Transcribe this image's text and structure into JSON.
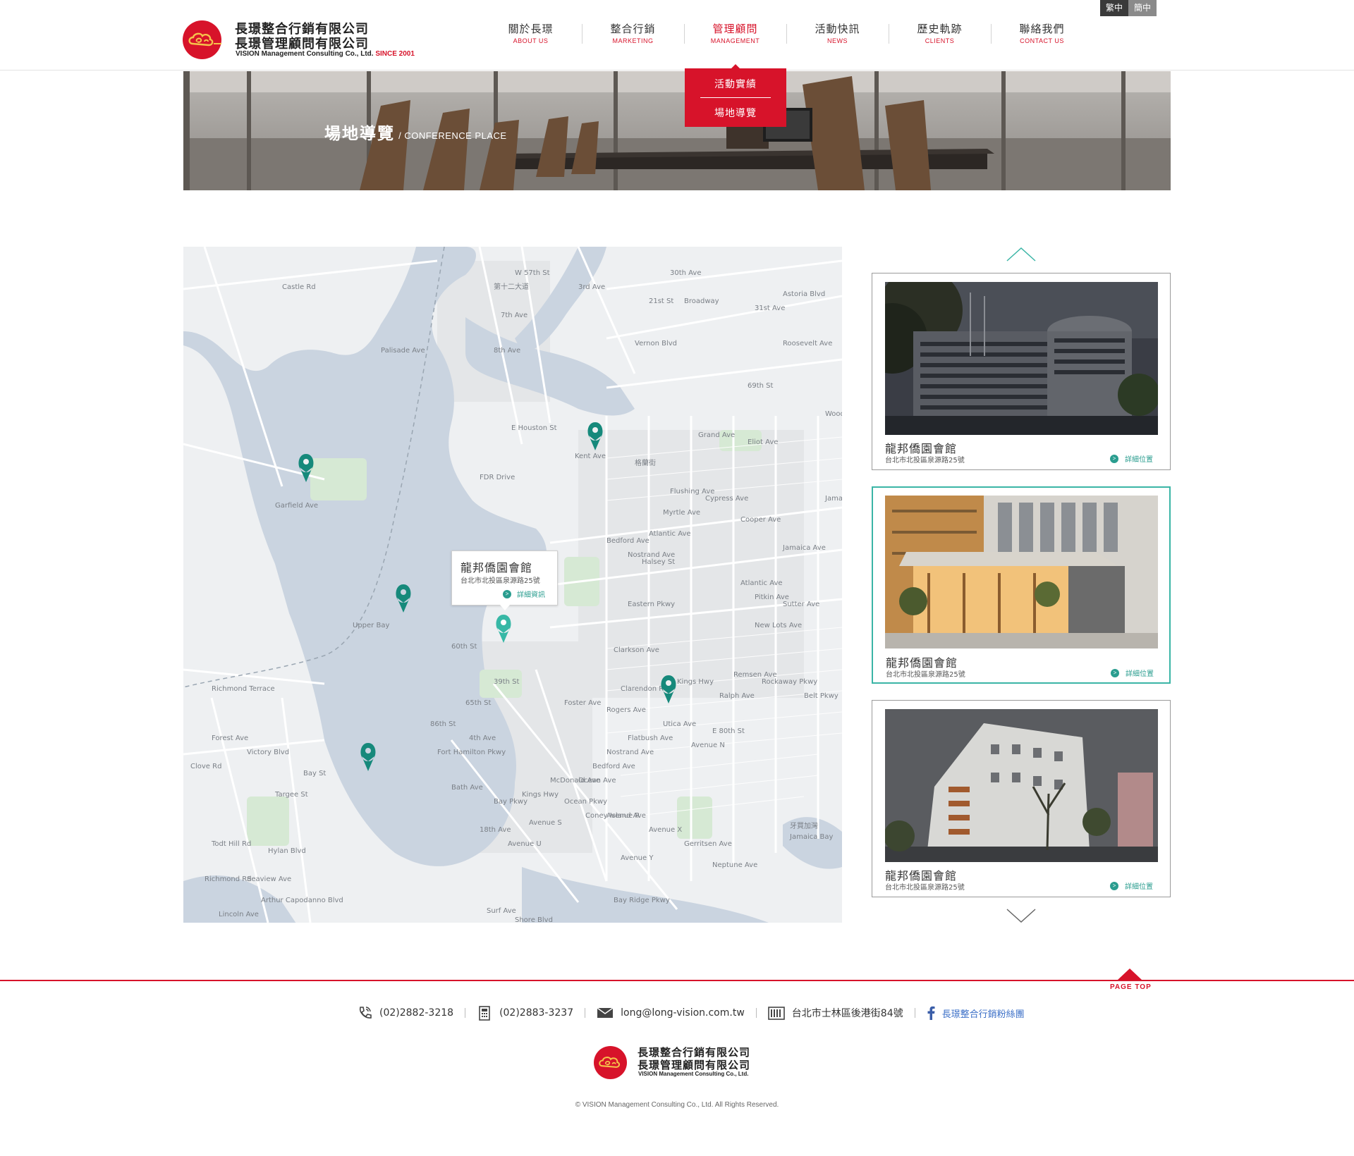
{
  "brand": {
    "name_line1": "長璟整合行銷有限公司",
    "name_line2": "長璟管理顧問有限公司",
    "name_en": "VISION Management Consulting Co., Ltd.",
    "since": "SINCE 2001",
    "colors": {
      "brand_red": "#d7132a",
      "accent_teal": "#2a9d8f",
      "active_border": "#3bb5a6"
    }
  },
  "lang": {
    "trad": "繁中",
    "simp": "簡中"
  },
  "nav": [
    {
      "zh": "關於長璟",
      "en": "ABOUT US"
    },
    {
      "zh": "整合行銷",
      "en": "MARKETING"
    },
    {
      "zh": "管理顧問",
      "en": "MANAGEMENT",
      "active": true
    },
    {
      "zh": "活動快訊",
      "en": "NEWS"
    },
    {
      "zh": "歷史軌跡",
      "en": "CLIENTS"
    },
    {
      "zh": "聯絡我們",
      "en": "CONTACT US"
    }
  ],
  "submenu": [
    "活動實績",
    "場地導覽"
  ],
  "banner": {
    "title_zh": "場地導覽",
    "title_en": "/ CONFERENCE PLACE"
  },
  "map": {
    "popup": {
      "name": "龍邦僑園會館",
      "address": "台北市北投區泉源路25號",
      "link": "詳細資訊"
    },
    "street_labels": [
      "W 57th St",
      "3rd Ave",
      "30th Ave",
      "21st St",
      "Broadway",
      "31st Ave",
      "Astoria Blvd",
      "Roosevelt Ave",
      "69th St",
      "Grand Ave",
      "Eliot Ave",
      "8th Ave",
      "E Houston St",
      "FDR Drive",
      "格蘭街",
      "Flushing Ave",
      "Cypress Ave",
      "Myrtle Ave",
      "Cooper Ave",
      "Bedford Ave",
      "Nostrand Ave",
      "Halsey St",
      "Jamaica Ave",
      "Atlantic Ave",
      "Pitkin Ave",
      "Sutter Ave",
      "New Lots Ave",
      "Eastern Pkwy",
      "Clarkson Ave",
      "Clarendon Rd",
      "Kings Hwy",
      "Ralph Ave",
      "Remsen Ave",
      "Rockaway Pkwy",
      "E 80th St",
      "Belt Pkwy",
      "Utica Ave",
      "Avenue N",
      "Flatbush Ave",
      "Nostrand Ave",
      "Bedford Ave",
      "Ocean Ave",
      "McDonald Ave",
      "Ocean Pkwy",
      "Coney Island Ave",
      "Avenue R",
      "Avenue S",
      "Avenue U",
      "Avenue X",
      "Avenue Y",
      "Gerritsen Ave",
      "Neptune Ave",
      "Surf Ave",
      "Shore Blvd",
      "Bay Ridge Pkwy",
      "Fort Hamilton Pkwy",
      "65th St",
      "60th St",
      "86th St",
      "Bath Ave",
      "18th Ave",
      "Bay Pkwy",
      "Kings Hwy",
      "Foster Ave",
      "Rogers Ave",
      "Upper Bay",
      "Richmond Terrace",
      "Forest Ave",
      "Clove Rd",
      "Victory Blvd",
      "Targee St",
      "Bay St",
      "Hylan Blvd",
      "Seaview Ave",
      "Richmond Rd",
      "Todt Hill Rd",
      "Lincoln Ave",
      "Arthur Capodanno Blvd",
      "Palisade Ave",
      "Garfield Ave",
      "Castle Rd",
      "Vernon Blvd",
      "Atlantic Ave",
      "Jamaica Bay",
      "牙買加灣",
      "Woodha",
      "Jama",
      "Kent Ave",
      "39th St",
      "4th Ave",
      "7th Ave",
      "第十二大道"
    ]
  },
  "venues": [
    {
      "name": "龍邦僑園會館",
      "address": "台北市北投區泉源路25號",
      "link": "詳細位置"
    },
    {
      "name": "龍邦僑園會館",
      "address": "台北市北投區泉源路25號",
      "link": "詳細位置",
      "active": true
    },
    {
      "name": "龍邦僑園會館",
      "address": "台北市北投區泉源路25號",
      "link": "詳細位置"
    }
  ],
  "footer": {
    "page_top": "PAGE TOP",
    "phone": "(02)2882-3218",
    "fax": "(02)2883-3237",
    "email": "long@long-vision.com.tw",
    "address": "台北市士林區後港街84號",
    "facebook": "長璟整合行銷粉絲團",
    "copyright": "© VISION Management Consulting Co., Ltd. All Rights Reserved."
  }
}
